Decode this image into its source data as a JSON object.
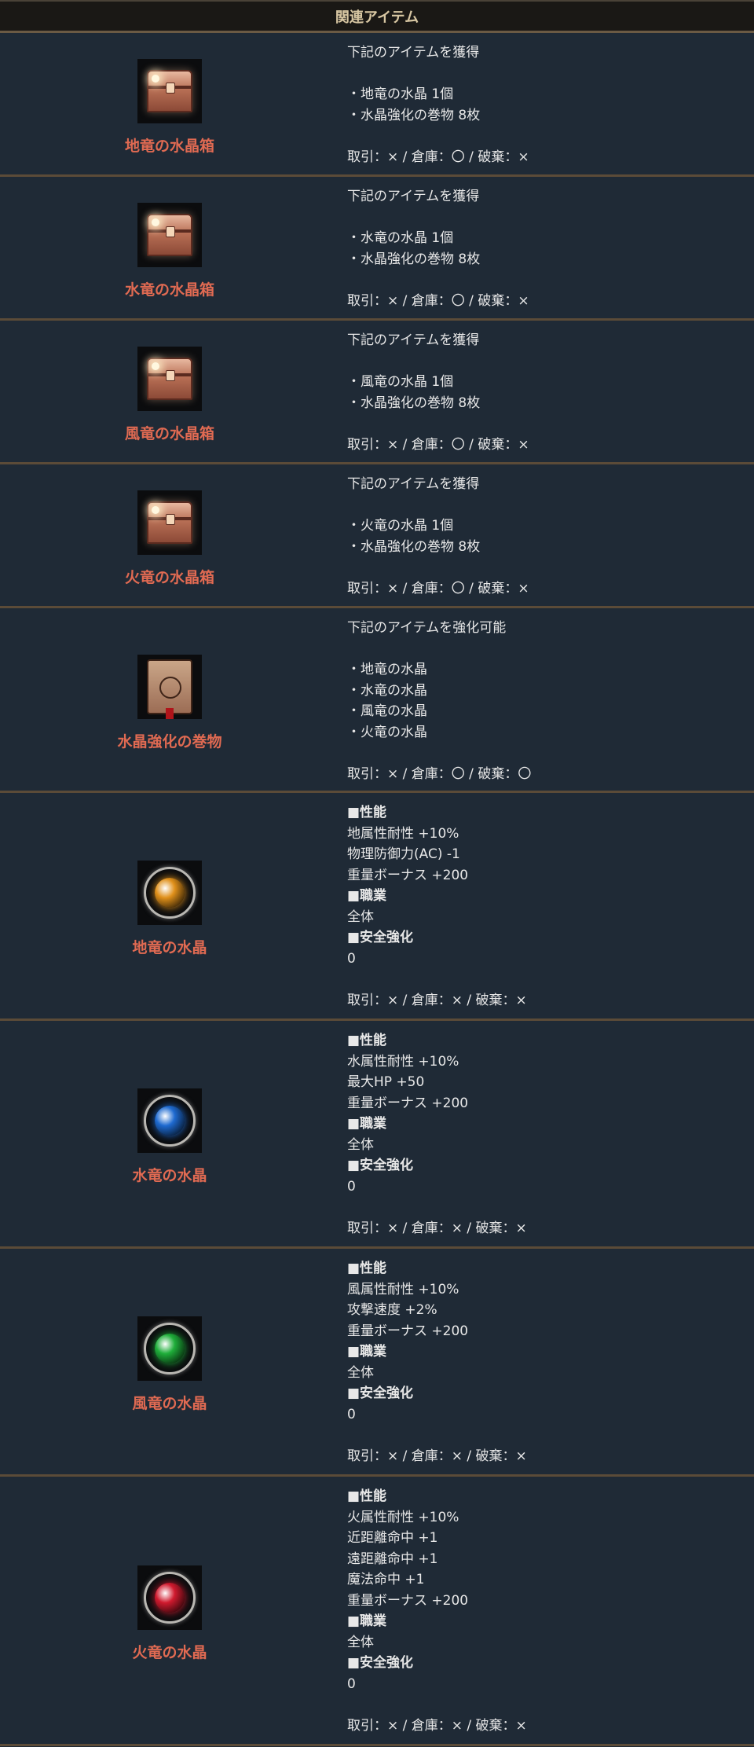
{
  "header": {
    "title": "関連アイテム"
  },
  "items": [
    {
      "name": "地竜の水晶箱",
      "icon": "treasure-chest-icon",
      "lines": [
        "下記のアイテムを獲得",
        "",
        "・地竜の水晶 1個",
        "・水晶強化の巻物 8枚",
        "",
        "取引：× / 倉庫：〇 / 破棄：×"
      ]
    },
    {
      "name": "水竜の水晶箱",
      "icon": "treasure-chest-icon",
      "lines": [
        "下記のアイテムを獲得",
        "",
        "・水竜の水晶 1個",
        "・水晶強化の巻物 8枚",
        "",
        "取引：× / 倉庫：〇 / 破棄：×"
      ]
    },
    {
      "name": "風竜の水晶箱",
      "icon": "treasure-chest-icon",
      "lines": [
        "下記のアイテムを獲得",
        "",
        "・風竜の水晶 1個",
        "・水晶強化の巻物 8枚",
        "",
        "取引：× / 倉庫：〇 / 破棄：×"
      ]
    },
    {
      "name": "火竜の水晶箱",
      "icon": "treasure-chest-icon",
      "lines": [
        "下記のアイテムを獲得",
        "",
        "・火竜の水晶 1個",
        "・水晶強化の巻物 8枚",
        "",
        "取引：× / 倉庫：〇 / 破棄：×"
      ]
    },
    {
      "name": "水晶強化の巻物",
      "icon": "scroll-icon",
      "lines": [
        "下記のアイテムを強化可能",
        "",
        "・地竜の水晶",
        "・水竜の水晶",
        "・風竜の水晶",
        "・火竜の水晶",
        "",
        "取引：× / 倉庫：〇 / 破棄：〇"
      ]
    },
    {
      "name": "地竜の水晶",
      "icon": "amber-orb-icon",
      "orb_color": "#e0901a",
      "lines": [
        "■性能",
        "地属性耐性 +10%",
        "物理防御力(AC) -1",
        "重量ボーナス +200",
        "■職業",
        "全体",
        "■安全強化",
        "0",
        "",
        "取引：× / 倉庫：× / 破棄：×"
      ],
      "bold": [
        0,
        4,
        6
      ]
    },
    {
      "name": "水竜の水晶",
      "icon": "blue-orb-icon",
      "orb_color": "#1e6ad0",
      "lines": [
        "■性能",
        "水属性耐性 +10%",
        "最大HP +50",
        "重量ボーナス +200",
        "■職業",
        "全体",
        "■安全強化",
        "0",
        "",
        "取引：× / 倉庫：× / 破棄：×"
      ],
      "bold": [
        0,
        4,
        6
      ]
    },
    {
      "name": "風竜の水晶",
      "icon": "green-orb-icon",
      "orb_color": "#1fae3a",
      "lines": [
        "■性能",
        "風属性耐性 +10%",
        "攻撃速度 +2%",
        "重量ボーナス +200",
        "■職業",
        "全体",
        "■安全強化",
        "0",
        "",
        "取引：× / 倉庫：× / 破棄：×"
      ],
      "bold": [
        0,
        4,
        6
      ]
    },
    {
      "name": "火竜の水晶",
      "icon": "red-orb-icon",
      "orb_color": "#d01a2e",
      "lines": [
        "■性能",
        "火属性耐性 +10%",
        "近距離命中 +1",
        "遠距離命中 +1",
        "魔法命中 +1",
        "重量ボーナス +200",
        "■職業",
        "全体",
        "■安全強化",
        "0",
        "",
        "取引：× / 倉庫：× / 破棄：×"
      ],
      "bold": [
        0,
        6,
        8
      ]
    }
  ]
}
